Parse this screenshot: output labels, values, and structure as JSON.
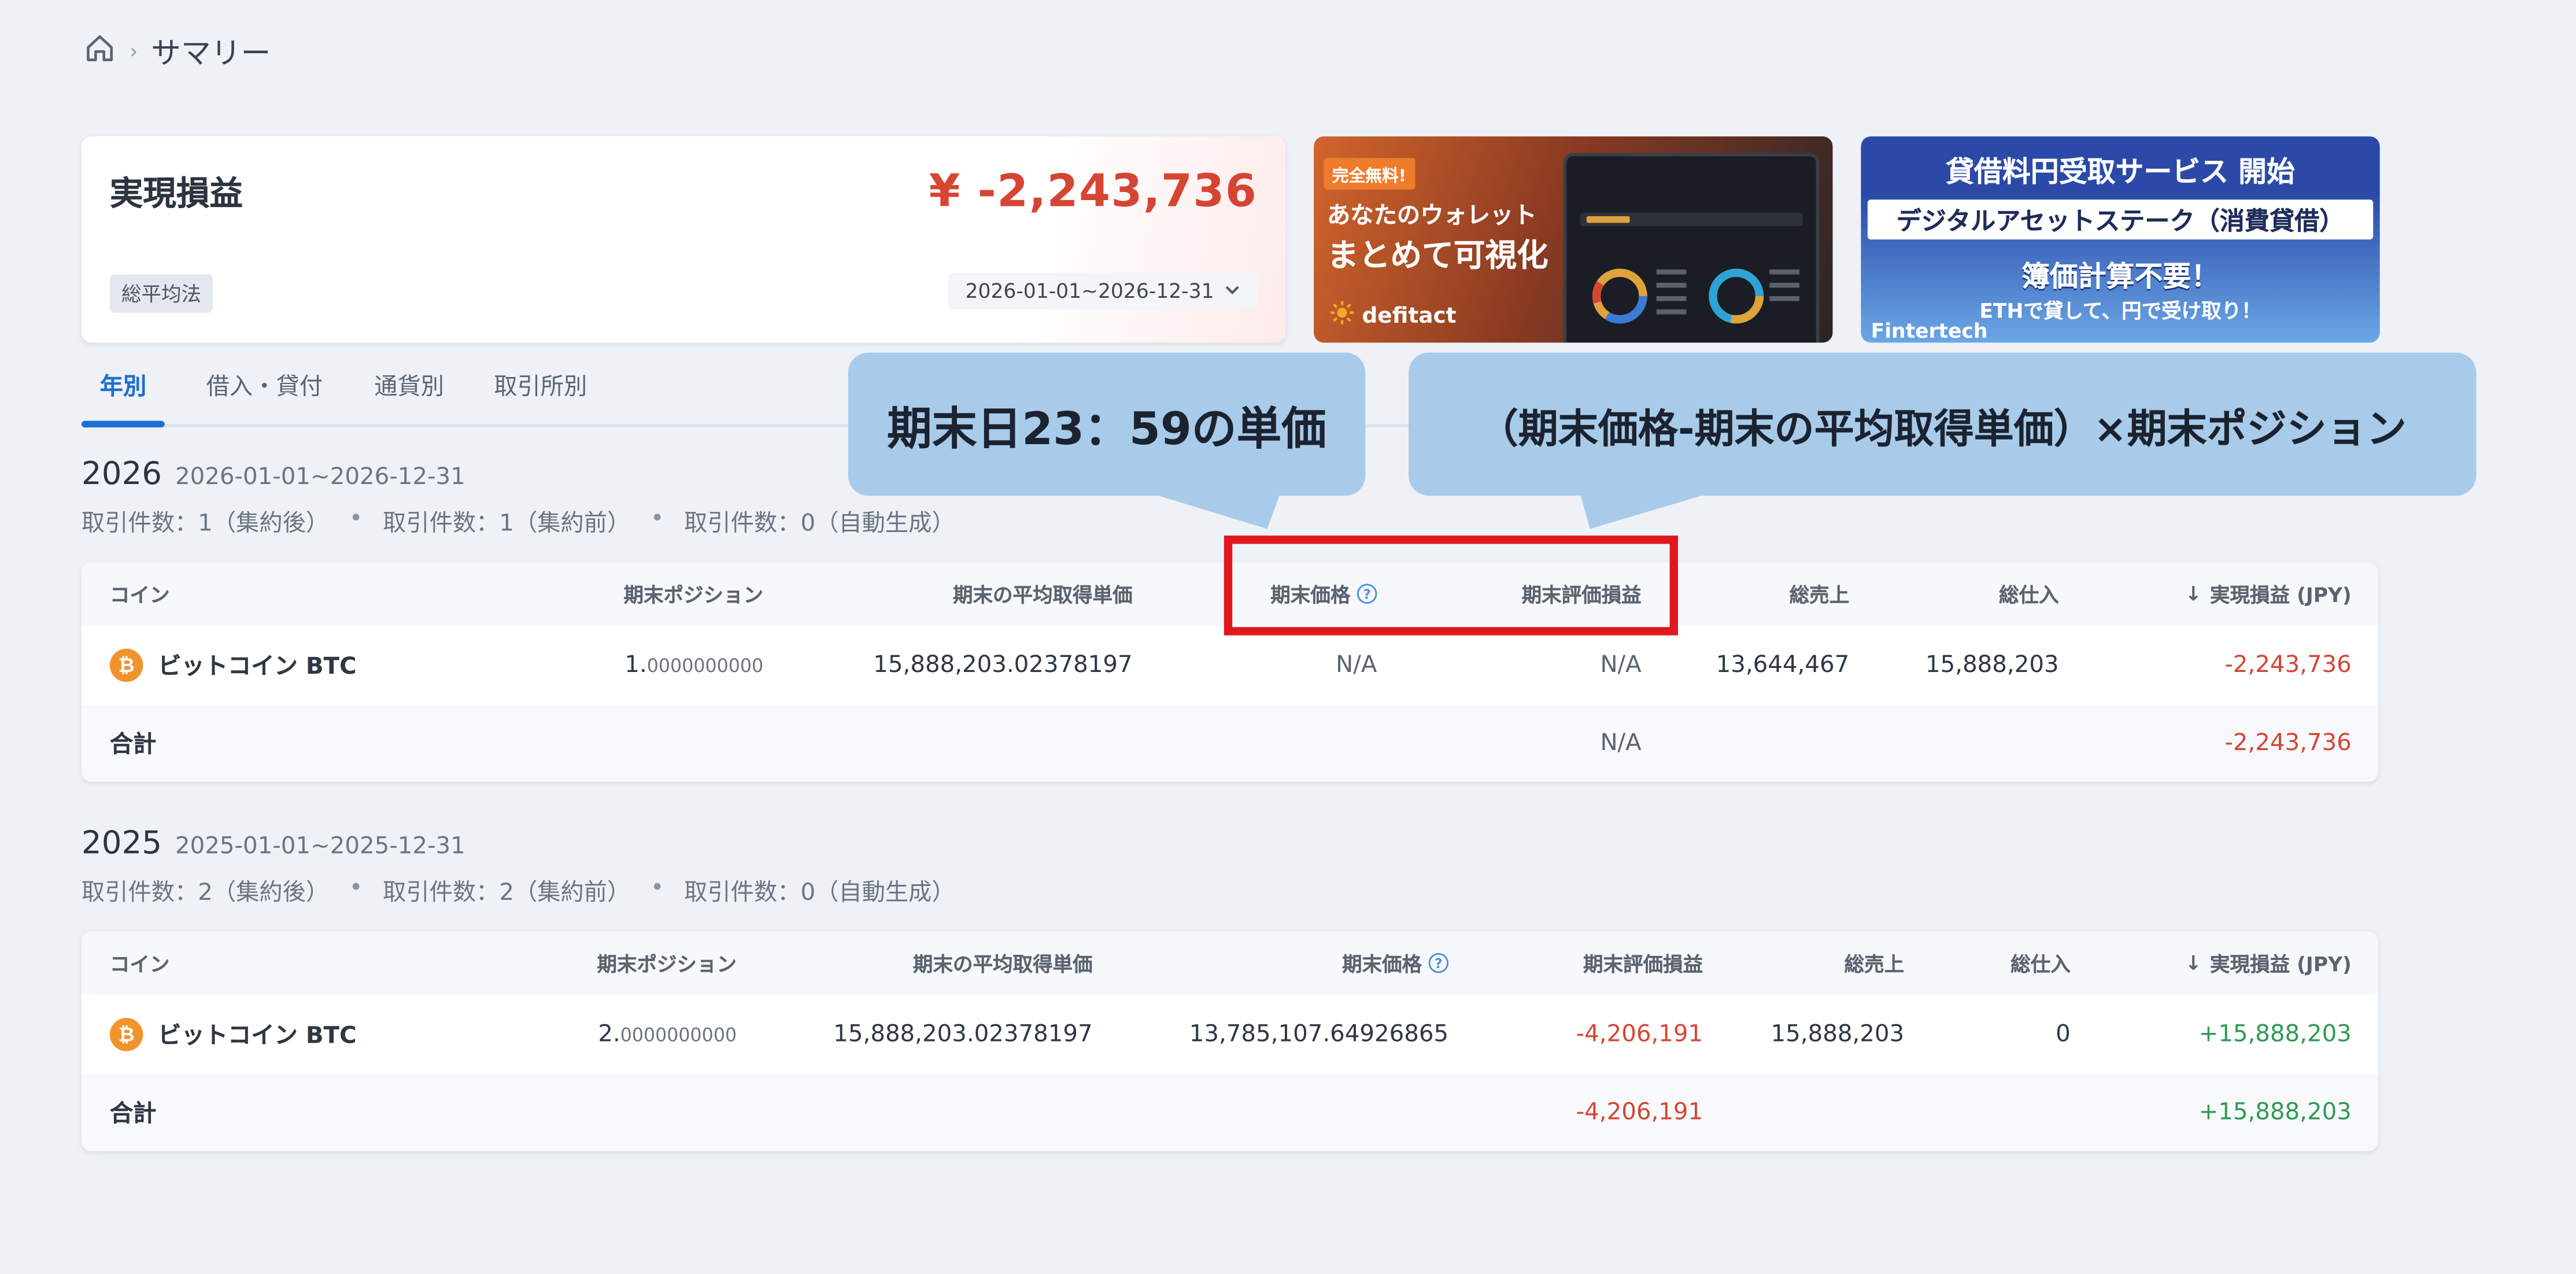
{
  "breadcrumb": {
    "current": "サマリー"
  },
  "summary": {
    "title": "実現損益",
    "amount": "¥ -2,243,736",
    "method_badge": "総平均法",
    "date_range": "2026-01-01~2026-12-31"
  },
  "banners": [
    {
      "tag": "完全無料!",
      "line1": "あなたのウォレット",
      "line2": "まとめて可視化",
      "brand": "defitact"
    },
    {
      "line1": "貸借料円受取サービス 開始",
      "line2": "デジタルアセットステーク（消費貸借）",
      "line3": "簿価計算不要！",
      "line4": "ETHで貸して、円で受け取り！",
      "brand": "Fintertech"
    }
  ],
  "tabs": [
    {
      "label": "年別",
      "active": true
    },
    {
      "label": "借入・貸付",
      "active": false
    },
    {
      "label": "通貨別",
      "active": false
    },
    {
      "label": "取引所別",
      "active": false
    }
  ],
  "callouts": {
    "left": "期末日23：59の単価",
    "right": "（期末価格-期末の平均取得単価）×期末ポジション"
  },
  "columns": {
    "coin": "コイン",
    "position": "期末ポジション",
    "avg_cost": "期末の平均取得単価",
    "end_price": "期末価格",
    "unrealized": "期末評価損益",
    "sales": "総売上",
    "purchases": "総仕入",
    "realized": "実現損益 (JPY)"
  },
  "years": [
    {
      "year": "2026",
      "range": "2026-01-01~2026-12-31",
      "counts": [
        "取引件数：1（集約後）",
        "取引件数：1（集約前）",
        "取引件数：0（自動生成）"
      ],
      "rows": [
        {
          "coin": "ビットコイン BTC",
          "position_int": "1.",
          "position_dec": "0000000000",
          "avg_cost": "15,888,203.02378197",
          "end_price": "N/A",
          "unrealized": "N/A",
          "sales": "13,644,467",
          "purchases": "15,888,203",
          "realized": "-2,243,736"
        }
      ],
      "total": {
        "label": "合計",
        "unrealized": "N/A",
        "realized": "-2,243,736"
      }
    },
    {
      "year": "2025",
      "range": "2025-01-01~2025-12-31",
      "counts": [
        "取引件数：2（集約後）",
        "取引件数：2（集約前）",
        "取引件数：0（自動生成）"
      ],
      "rows": [
        {
          "coin": "ビットコイン BTC",
          "position_int": "2.",
          "position_dec": "0000000000",
          "avg_cost": "15,888,203.02378197",
          "end_price": "13,785,107.64926865",
          "unrealized": "-4,206,191",
          "sales": "15,888,203",
          "purchases": "0",
          "realized": "+15,888,203"
        }
      ],
      "total": {
        "label": "合計",
        "unrealized": "-4,206,191",
        "realized": "+15,888,203"
      }
    }
  ],
  "colors": {
    "accent": "#1e6fd6",
    "negative": "#d64534",
    "positive": "#2f9a54",
    "callout": "#a9cbea",
    "highlight": "#e0181e"
  }
}
